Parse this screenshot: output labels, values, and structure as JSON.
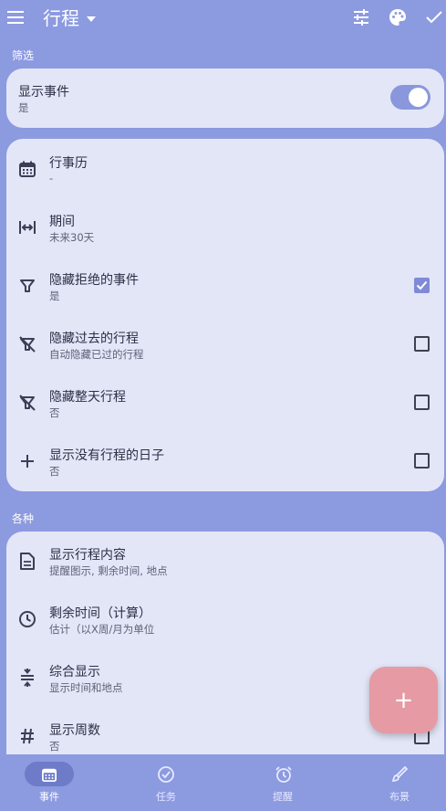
{
  "topbar": {
    "title": "行程",
    "icons": [
      "menu-icon",
      "dropdown-icon",
      "tune-icon",
      "palette-icon",
      "check-icon"
    ]
  },
  "sections": {
    "filter_label": "筛选",
    "misc_label": "各种"
  },
  "show_events": {
    "title": "显示事件",
    "subtitle": "是",
    "enabled": true
  },
  "filter_rows": [
    {
      "title": "行事历",
      "subtitle": "-",
      "icon": "calendar-icon",
      "checkbox": null
    },
    {
      "title": "期间",
      "subtitle": "未来30天",
      "icon": "range-icon",
      "checkbox": null
    },
    {
      "title": "隐藏拒绝的事件",
      "subtitle": "是",
      "icon": "filter-icon",
      "checkbox": true
    },
    {
      "title": "隐藏过去的行程",
      "subtitle": "自动隐藏已过的行程",
      "icon": "filter-off-icon",
      "checkbox": false
    },
    {
      "title": "隐藏整天行程",
      "subtitle": "否",
      "icon": "filter-off-icon",
      "checkbox": false
    },
    {
      "title": "显示没有行程的日子",
      "subtitle": "否",
      "icon": "plus-icon",
      "checkbox": false
    }
  ],
  "misc_rows": [
    {
      "title": "显示行程内容",
      "subtitle": "提醒图示, 剩余时间, 地点",
      "icon": "document-icon"
    },
    {
      "title": "剩余时间（计算）",
      "subtitle": "估计（以X周/月为单位",
      "icon": "clock-icon"
    },
    {
      "title": "综合显示",
      "subtitle": "显示时间和地点",
      "icon": "compress-icon"
    },
    {
      "title": "显示周数",
      "subtitle": "否",
      "icon": "hash-icon"
    }
  ],
  "fab": {
    "label": "+"
  },
  "nav": [
    {
      "label": "事件",
      "icon": "calendar-icon",
      "active": true
    },
    {
      "label": "任务",
      "icon": "check-circle-icon",
      "active": false
    },
    {
      "label": "提醒",
      "icon": "alarm-icon",
      "active": false
    },
    {
      "label": "布景",
      "icon": "brush-icon",
      "active": false
    }
  ],
  "colors": {
    "background": "#8c9ae0",
    "card": "#e3e6f7",
    "accent": "#7f8bd6",
    "fab": "#e59aa4"
  }
}
